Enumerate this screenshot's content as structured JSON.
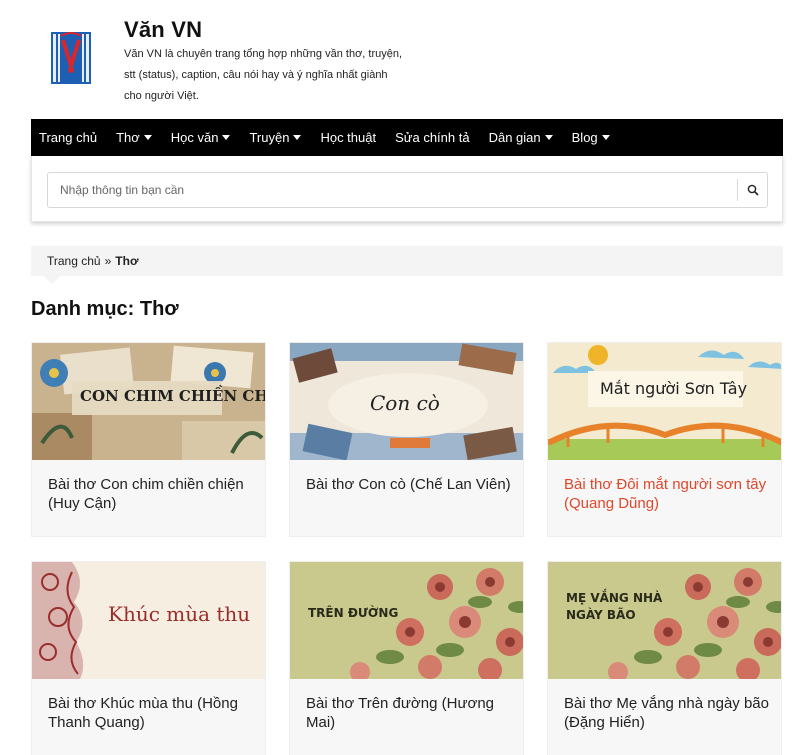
{
  "site": {
    "title": "Văn VN",
    "description": "Văn VN là chuyên trang tổng hợp những vần thơ, truyện, stt (status), caption, câu nói hay và ý nghĩa nhất giành cho người Việt."
  },
  "nav": {
    "items": [
      {
        "label": "Trang chủ",
        "dropdown": false
      },
      {
        "label": "Thơ",
        "dropdown": true
      },
      {
        "label": "Học văn",
        "dropdown": true
      },
      {
        "label": "Truyện",
        "dropdown": true
      },
      {
        "label": "Học thuật",
        "dropdown": false
      },
      {
        "label": "Sửa chính tả",
        "dropdown": false
      },
      {
        "label": "Dân gian",
        "dropdown": true
      },
      {
        "label": "Blog",
        "dropdown": true
      }
    ]
  },
  "search": {
    "placeholder": "Nhập thông tin bạn cần",
    "icon": "search-icon"
  },
  "breadcrumb": {
    "home": "Trang chủ",
    "separator": "»",
    "current": "Thơ"
  },
  "page": {
    "title": "Danh mục: Thơ"
  },
  "cards": [
    {
      "title": "Bài thơ Con chim chiền chiện (Huy Cận)",
      "image_text": "CON CHIM CHIỀN CHIỆN",
      "active": false
    },
    {
      "title": "Bài thơ Con cò (Chế Lan Viên)",
      "image_text": "Con cò",
      "active": false
    },
    {
      "title": "Bài thơ Đôi mắt người sơn tây (Quang Dũng)",
      "image_text": "Mắt người Sơn Tây",
      "active": true
    },
    {
      "title": "Bài thơ Khúc mùa thu (Hồng Thanh Quang)",
      "image_text": "Khúc mùa thu",
      "active": false
    },
    {
      "title": "Bài thơ Trên đường (Hương Mai)",
      "image_text": "TRÊN ĐƯỜNG",
      "active": false
    },
    {
      "title": "Bài thơ Mẹ vắng nhà ngày bão (Đặng Hiển)",
      "image_text_line1": "MẸ VẮNG NHÀ",
      "image_text_line2": "NGÀY BÃO",
      "active": false
    }
  ],
  "colors": {
    "nav_bg": "#000000",
    "active_link": "#e0472b",
    "breadcrumb_bg": "#f4f4f4",
    "card_bg": "#f7f7f7"
  }
}
